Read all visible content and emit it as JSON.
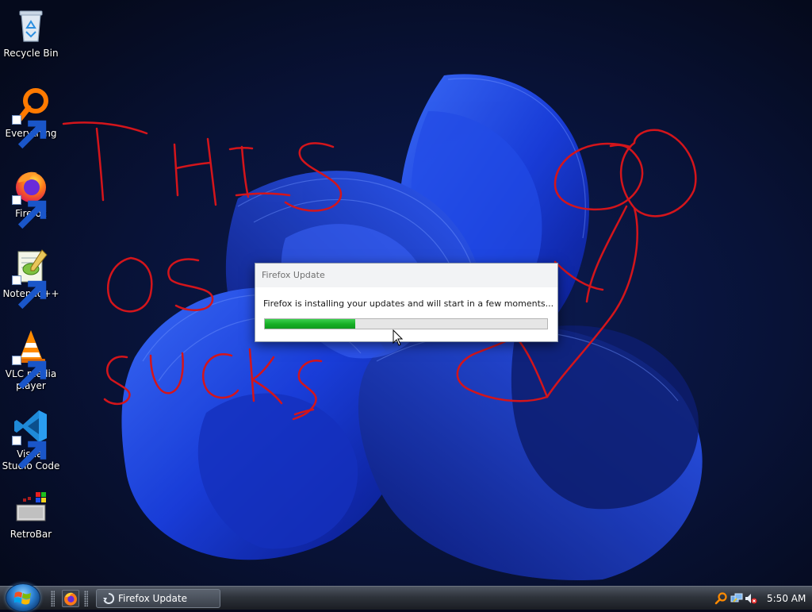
{
  "desktop": {
    "icons": [
      {
        "label": "Recycle Bin",
        "icon": "recycle-bin-icon",
        "shortcut": false
      },
      {
        "label": "Everything",
        "icon": "everything-search-icon",
        "shortcut": true
      },
      {
        "label": "Firefox",
        "icon": "firefox-icon",
        "shortcut": true
      },
      {
        "label": "Notepad++",
        "icon": "notepad-plus-plus-icon",
        "shortcut": true
      },
      {
        "label": "VLC media player",
        "icon": "vlc-icon",
        "shortcut": true
      },
      {
        "label": "Visual Studio Code",
        "icon": "vscode-icon",
        "shortcut": true
      },
      {
        "label": "RetroBar",
        "icon": "retrobar-icon",
        "shortcut": false
      }
    ],
    "scribble_text": [
      "THIS",
      "OS",
      "SUCKS"
    ],
    "scribble_color": "#d4151b"
  },
  "dialog": {
    "title": "Firefox Update",
    "message": "Firefox is installing your updates and will start in a few moments...",
    "progress_fraction": 0.32,
    "progress_color": "#1fb82e"
  },
  "taskbar": {
    "start_icon": "windows-orb-icon",
    "quick_launch": [
      "firefox-icon"
    ],
    "task_button_label": "Firefox Update",
    "task_button_icon": "update-spinner-icon",
    "tray_icons": [
      "everything-search-icon",
      "network-icon",
      "volume-muted-icon"
    ],
    "clock": "5:50 AM"
  }
}
